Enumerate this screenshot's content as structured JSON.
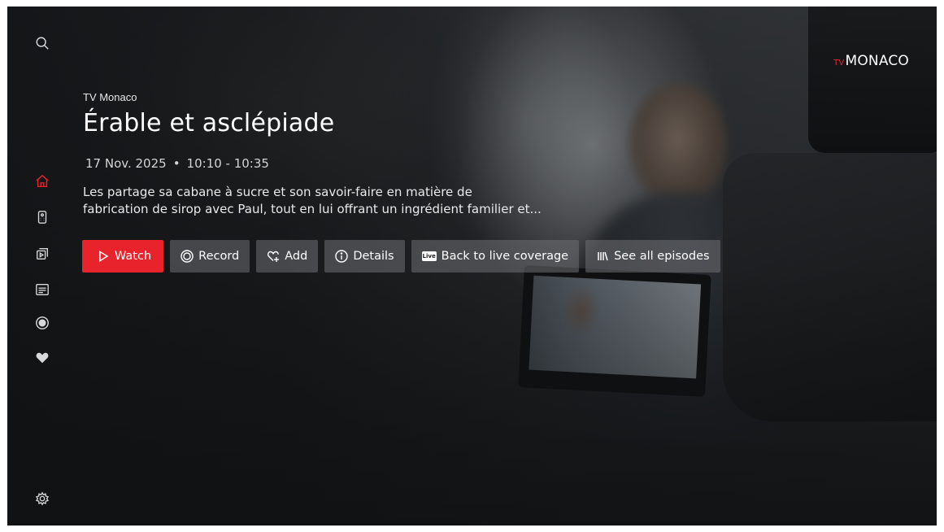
{
  "brand": {
    "logo_prefix": "TV",
    "logo_name": "MONACO",
    "accent": "#e8232b"
  },
  "sidebar": {
    "items": [
      {
        "name": "search",
        "icon": "search-icon"
      },
      {
        "name": "home",
        "icon": "home-icon",
        "active": true
      },
      {
        "name": "remote",
        "icon": "remote-icon"
      },
      {
        "name": "library",
        "icon": "library-icon"
      },
      {
        "name": "guide",
        "icon": "guide-icon"
      },
      {
        "name": "recordings",
        "icon": "record-icon"
      },
      {
        "name": "favorites",
        "icon": "heart-icon"
      },
      {
        "name": "settings",
        "icon": "gear-icon"
      }
    ]
  },
  "program": {
    "channel": "TV Monaco",
    "title": "Érable et asclépiade",
    "date": "17 Nov. 2025",
    "separator": "•",
    "time": "10:10 - 10:35",
    "description_line1": "Les partage sa cabane à sucre et son savoir-faire en matière de",
    "description_line2": "fabrication de sirop avec Paul, tout en lui offrant un ingrédient familier et..."
  },
  "actions": {
    "watch": "Watch",
    "record": "Record",
    "add": "Add",
    "details": "Details",
    "live_badge": "Live",
    "back_to_live": "Back to live coverage",
    "episodes": "See all episodes"
  }
}
